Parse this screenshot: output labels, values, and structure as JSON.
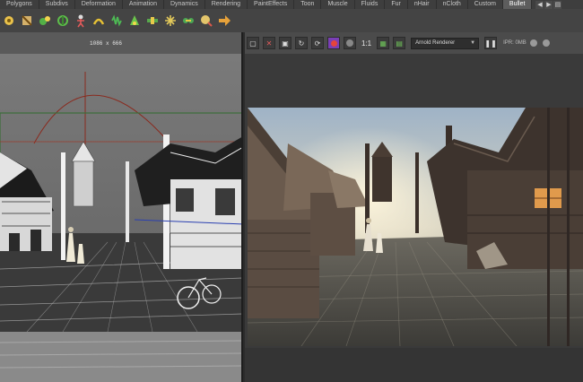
{
  "shelf": {
    "tabs": [
      {
        "label": "Polygons",
        "active": false
      },
      {
        "label": "Subdivs",
        "active": false
      },
      {
        "label": "Deformation",
        "active": false
      },
      {
        "label": "Animation",
        "active": false
      },
      {
        "label": "Dynamics",
        "active": false
      },
      {
        "label": "Rendering",
        "active": false
      },
      {
        "label": "PaintEffects",
        "active": false
      },
      {
        "label": "Toon",
        "active": false
      },
      {
        "label": "Muscle",
        "active": false
      },
      {
        "label": "Fluids",
        "active": false
      },
      {
        "label": "Fur",
        "active": false
      },
      {
        "label": "nHair",
        "active": false
      },
      {
        "label": "nCloth",
        "active": false
      },
      {
        "label": "Custom",
        "active": false
      },
      {
        "label": "Bullet",
        "active": true
      }
    ]
  },
  "viewport": {
    "resolution": "1086 x 666"
  },
  "render_view": {
    "ratio": "1:1",
    "renderer": "Arnold Renderer",
    "ipr_status": "IPR: 0MB"
  }
}
